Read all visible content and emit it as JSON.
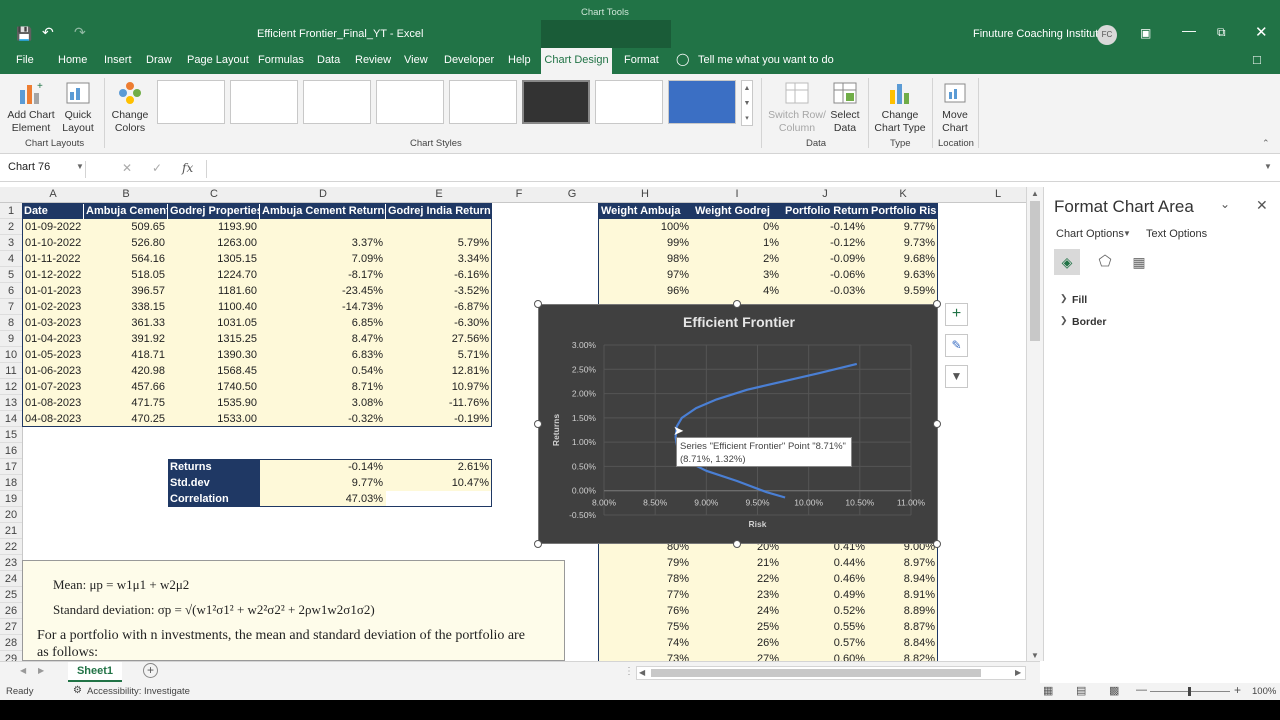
{
  "window": {
    "title": "Efficient Frontier_Final_YT  -  Excel",
    "context_tab": "Chart Tools",
    "user": "Finuture Coaching Institute",
    "user_initials": "FC"
  },
  "menu": [
    "File",
    "Home",
    "Insert",
    "Draw",
    "Page Layout",
    "Formulas",
    "Data",
    "Review",
    "View",
    "Developer",
    "Help",
    "Chart Design",
    "Format"
  ],
  "active_menu": "Chart Design",
  "tell_me": "Tell me what you want to do",
  "ribbon": {
    "add_chart_element": "Add Chart Element",
    "quick_layout": "Quick Layout",
    "change_colors": "Change Colors",
    "switch_row_col": "Switch Row/ Column",
    "select_data": "Select Data",
    "change_chart_type": "Change Chart Type",
    "move_chart": "Move Chart",
    "groups": {
      "chart_layouts": "Chart Layouts",
      "chart_styles": "Chart Styles",
      "data": "Data",
      "type": "Type",
      "location": "Location"
    }
  },
  "formula_bar": {
    "name_box": "Chart 76",
    "fx": "fx",
    "value": ""
  },
  "columns": [
    "A",
    "B",
    "C",
    "D",
    "E",
    "F",
    "G",
    "H",
    "I",
    "J",
    "K",
    "L"
  ],
  "rows": [
    "1",
    "2",
    "3",
    "4",
    "5",
    "6",
    "7",
    "8",
    "9",
    "10",
    "11",
    "12",
    "13",
    "14",
    "15",
    "16",
    "17",
    "18",
    "19",
    "20",
    "21",
    "22",
    "23",
    "24",
    "25",
    "26",
    "27",
    "28",
    "29"
  ],
  "table1": {
    "headers": [
      "Date",
      "Ambuja Cement",
      "Godrej Properties",
      "Ambuja Cement Returns",
      "Godrej India Returns"
    ],
    "rows": [
      [
        "01-09-2022",
        "509.65",
        "1193.90",
        "",
        ""
      ],
      [
        "01-10-2022",
        "526.80",
        "1263.00",
        "3.37%",
        "5.79%"
      ],
      [
        "01-11-2022",
        "564.16",
        "1305.15",
        "7.09%",
        "3.34%"
      ],
      [
        "01-12-2022",
        "518.05",
        "1224.70",
        "-8.17%",
        "-6.16%"
      ],
      [
        "01-01-2023",
        "396.57",
        "1181.60",
        "-23.45%",
        "-3.52%"
      ],
      [
        "01-02-2023",
        "338.15",
        "1100.40",
        "-14.73%",
        "-6.87%"
      ],
      [
        "01-03-2023",
        "361.33",
        "1031.05",
        "6.85%",
        "-6.30%"
      ],
      [
        "01-04-2023",
        "391.92",
        "1315.25",
        "8.47%",
        "27.56%"
      ],
      [
        "01-05-2023",
        "418.71",
        "1390.30",
        "6.83%",
        "5.71%"
      ],
      [
        "01-06-2023",
        "420.98",
        "1568.45",
        "0.54%",
        "12.81%"
      ],
      [
        "01-07-2023",
        "457.66",
        "1740.50",
        "8.71%",
        "10.97%"
      ],
      [
        "01-08-2023",
        "471.75",
        "1535.90",
        "3.08%",
        "-11.76%"
      ],
      [
        "04-08-2023",
        "470.25",
        "1533.00",
        "-0.32%",
        "-0.19%"
      ]
    ]
  },
  "stats": [
    {
      "label": "Returns",
      "d": "-0.14%",
      "e": "2.61%"
    },
    {
      "label": "Std.dev",
      "d": "9.77%",
      "e": "10.47%"
    },
    {
      "label": "Correlation",
      "d": "47.03%",
      "e": ""
    }
  ],
  "table2": {
    "headers": [
      "Weight Ambuja",
      "Weight Godrej",
      "Portfolio Return",
      "Portfolio Risk"
    ],
    "top_rows": [
      [
        "100%",
        "0%",
        "-0.14%",
        "9.77%"
      ],
      [
        "99%",
        "1%",
        "-0.12%",
        "9.73%"
      ],
      [
        "98%",
        "2%",
        "-0.09%",
        "9.68%"
      ],
      [
        "97%",
        "3%",
        "-0.06%",
        "9.63%"
      ],
      [
        "96%",
        "4%",
        "-0.03%",
        "9.59%"
      ]
    ],
    "bottom_rows": [
      [
        "80%",
        "20%",
        "0.41%",
        "9.00%"
      ],
      [
        "79%",
        "21%",
        "0.44%",
        "8.97%"
      ],
      [
        "78%",
        "22%",
        "0.46%",
        "8.94%"
      ],
      [
        "77%",
        "23%",
        "0.49%",
        "8.91%"
      ],
      [
        "76%",
        "24%",
        "0.52%",
        "8.89%"
      ],
      [
        "75%",
        "25%",
        "0.55%",
        "8.87%"
      ],
      [
        "74%",
        "26%",
        "0.57%",
        "8.84%"
      ],
      [
        "73%",
        "27%",
        "0.60%",
        "8.82%"
      ]
    ]
  },
  "formula_box": {
    "mean": "Mean: μp = w1μ1 + w2μ2",
    "std": "Standard deviation: σp = √(w1²σ1² + w2²σ2² + 2ρw1w2σ1σ2)",
    "text1": "For a portfolio with n investments, the mean and standard deviation of the portfolio are",
    "text2": "as follows:"
  },
  "chart_data": {
    "type": "scatter",
    "title": "Efficient Frontier",
    "xlabel": "Risk",
    "ylabel": "Returns",
    "xlim": [
      8.0,
      11.0
    ],
    "ylim": [
      -0.5,
      3.0
    ],
    "x_ticks": [
      "8.00%",
      "8.50%",
      "9.00%",
      "9.50%",
      "10.00%",
      "10.50%",
      "11.00%"
    ],
    "y_ticks": [
      "3.00%",
      "2.50%",
      "2.00%",
      "1.50%",
      "1.00%",
      "0.50%",
      "0.00%",
      "-0.50%"
    ],
    "series": [
      {
        "name": "Efficient Frontier",
        "color": "#4a7fd4",
        "x": [
          9.77,
          9.59,
          9.3,
          9.0,
          8.82,
          8.72,
          8.7,
          8.71,
          8.76,
          8.9,
          9.1,
          9.4,
          9.75,
          10.1,
          10.47
        ],
        "y": [
          -0.14,
          -0.03,
          0.2,
          0.41,
          0.6,
          0.85,
          1.1,
          1.32,
          1.5,
          1.7,
          1.88,
          2.08,
          2.25,
          2.42,
          2.61
        ]
      }
    ],
    "tooltip": {
      "line1": "Series \"Efficient Frontier\" Point \"8.71%\"",
      "line2": "(8.71%, 1.32%)"
    }
  },
  "pane": {
    "title": "Format Chart Area",
    "chart_options": "Chart Options",
    "text_options": "Text Options",
    "fill": "Fill",
    "border": "Border"
  },
  "sheet_tab": "Sheet1",
  "status": {
    "ready": "Ready",
    "accessibility": "Accessibility: Investigate",
    "zoom": "100%"
  },
  "colors": {
    "excel_green": "#217346",
    "header_navy": "#1f3864",
    "cell_yellow": "#fef9d9",
    "chart_bg": "#404040"
  }
}
